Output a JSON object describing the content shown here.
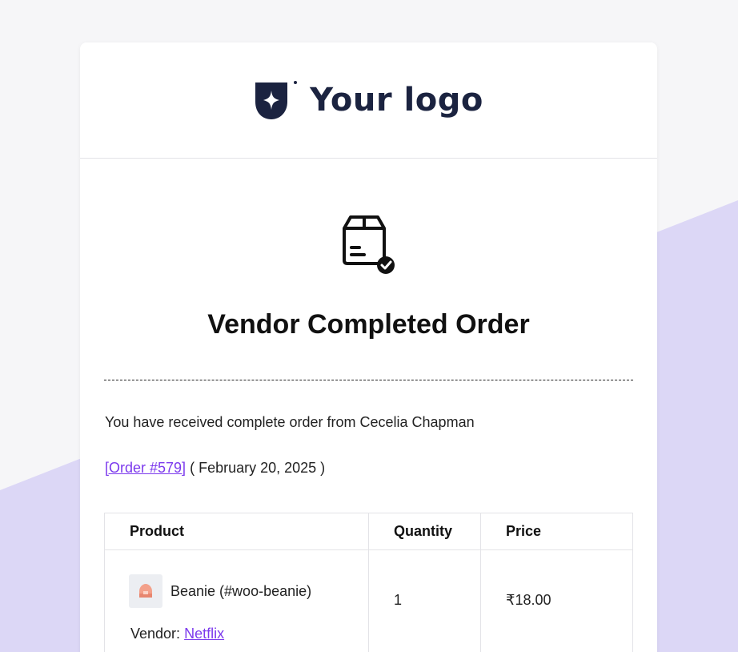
{
  "logo": {
    "text": "Your logo"
  },
  "email": {
    "title": "Vendor Completed Order",
    "intro": "You have received complete order from Cecelia Chapman",
    "order_link": "[Order #579]",
    "order_date": "( February 20, 2025 )"
  },
  "table": {
    "headers": {
      "product": "Product",
      "quantity": "Quantity",
      "price": "Price"
    },
    "rows": [
      {
        "product": "Beanie (#woo-beanie)",
        "vendor_label": "Vendor:",
        "vendor_name": "Netflix",
        "quantity": "1",
        "price": "₹18.00"
      }
    ]
  },
  "colors": {
    "accent": "#7c3aed",
    "background_shape": "#dcd7f6",
    "logo": "#1b2340"
  },
  "icons": [
    "logo-mark-icon",
    "package-check-icon",
    "beanie-thumbnail-icon"
  ]
}
